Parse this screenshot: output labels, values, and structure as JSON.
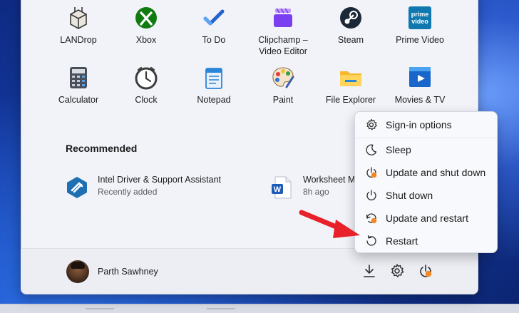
{
  "pinned_apps": [
    {
      "label": "LANDrop",
      "icon": "landrop-icon"
    },
    {
      "label": "Xbox",
      "icon": "xbox-icon"
    },
    {
      "label": "To Do",
      "icon": "todo-icon"
    },
    {
      "label": "Clipchamp – Video Editor",
      "icon": "clipchamp-icon"
    },
    {
      "label": "Steam",
      "icon": "steam-icon"
    },
    {
      "label": "Prime Video",
      "icon": "prime-video-icon"
    },
    {
      "label": "Calculator",
      "icon": "calculator-icon"
    },
    {
      "label": "Clock",
      "icon": "clock-icon"
    },
    {
      "label": "Notepad",
      "icon": "notepad-icon"
    },
    {
      "label": "Paint",
      "icon": "paint-icon"
    },
    {
      "label": "File Explorer",
      "icon": "file-explorer-icon"
    },
    {
      "label": "Movies & TV",
      "icon": "movies-tv-icon"
    }
  ],
  "recommended": {
    "title": "Recommended",
    "items": [
      {
        "name": "Intel Driver & Support Assistant",
        "sub": "Recently added",
        "icon": "intel-dsa-icon"
      },
      {
        "name": "Worksheet M",
        "sub": "8h ago",
        "icon": "word-doc-icon"
      }
    ]
  },
  "user": {
    "name": "Parth Sawhney"
  },
  "power_menu": {
    "items": [
      {
        "label": "Sign-in options",
        "icon": "gear-icon"
      },
      {
        "label": "Sleep",
        "icon": "moon-icon"
      },
      {
        "label": "Update and shut down",
        "icon": "update-power-icon"
      },
      {
        "label": "Shut down",
        "icon": "power-icon"
      },
      {
        "label": "Update and restart",
        "icon": "update-restart-icon"
      },
      {
        "label": "Restart",
        "icon": "restart-icon"
      }
    ]
  },
  "colors": {
    "accent_red": "#e8202a",
    "update_dot": "#f08a24",
    "xbox_green": "#107c10"
  }
}
